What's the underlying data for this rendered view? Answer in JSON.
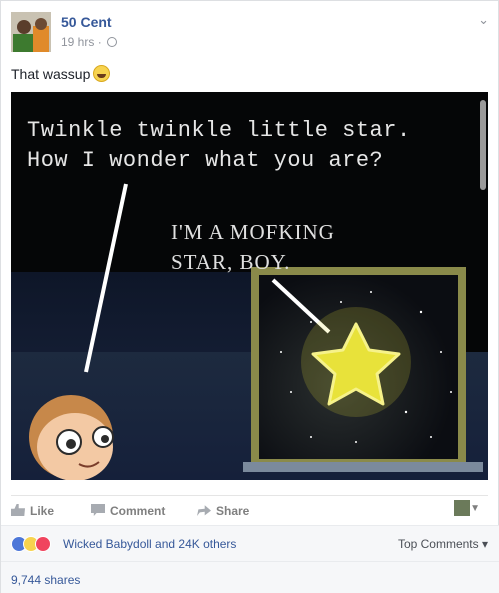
{
  "post": {
    "author": "50 Cent",
    "time": "19 hrs",
    "separator": "·",
    "caption": "That wassup",
    "caption_emoji": "laughing-emoji"
  },
  "meme": {
    "line1": "Twinkle twinkle little star.",
    "line2": "How I wonder what you are?",
    "reply1": "I'M A MOFKING",
    "reply2": "STAR, BOY.",
    "colors": {
      "background": "#050607",
      "star": "#e8e23a",
      "text": "#e6e6e6"
    }
  },
  "actions": {
    "like": "Like",
    "comment": "Comment",
    "share": "Share"
  },
  "reactions": {
    "summary": "Wicked Babydoll and 24K others",
    "sort": "Top Comments",
    "icons": [
      "like-icon",
      "haha-icon",
      "love-icon"
    ]
  },
  "shares": {
    "count": "9,744 shares"
  },
  "colors": {
    "link": "#365899",
    "meta": "#90949c"
  }
}
